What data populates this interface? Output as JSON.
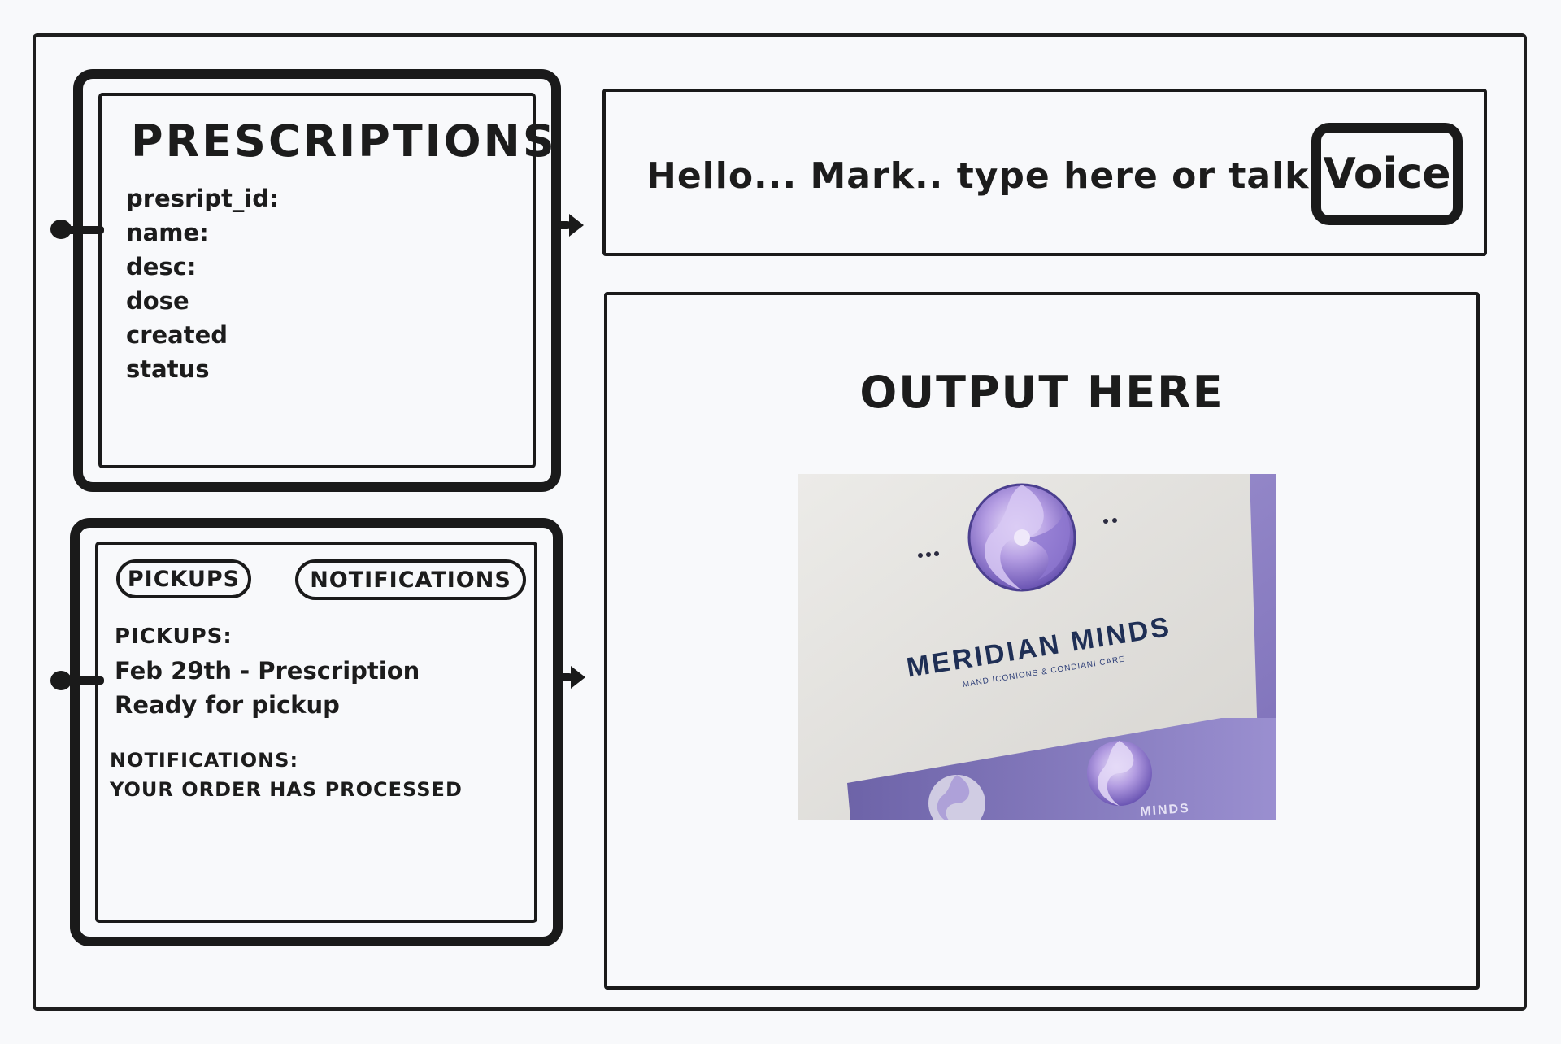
{
  "prescriptions": {
    "title": "PRESCRIPTIONS",
    "fields": [
      "presript_id:",
      "name:",
      "desc:",
      "dose",
      "created",
      "status"
    ]
  },
  "pickups_panel": {
    "tabs": {
      "pickups": "PICKUPS",
      "notifications": "NOTIFICATIONS"
    },
    "pickups_heading": "PICKUPS:",
    "pickup_line1": "Feb 29th - Prescription",
    "pickup_line2": "Ready for pickup",
    "notifications_heading": "NOTIFICATIONS:",
    "notification_message": "YOUR ORDER HAS PROCESSED"
  },
  "input": {
    "placeholder": "Hello... Mark.. type here or talk",
    "voice_label": "Voice"
  },
  "output": {
    "title": "OUTPUT HERE",
    "image": {
      "brand_name": "MERIDIAN MINDS",
      "tagline": "MAND ICONIONS & CONDIANI CARE",
      "partial_brand": "MINDS",
      "colors": {
        "background": "#9d8fd0",
        "card": "#e2e0dc",
        "brand_text": "#1f2f55"
      }
    }
  }
}
